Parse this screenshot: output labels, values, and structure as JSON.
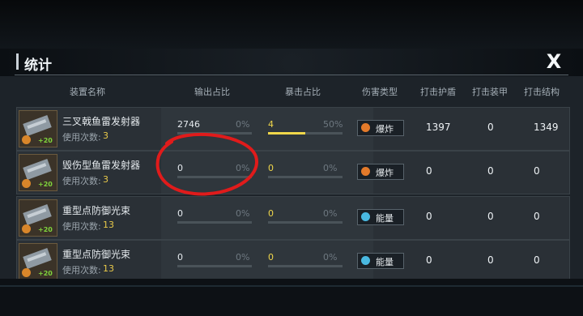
{
  "dialog": {
    "title": "统计",
    "close_label": "X"
  },
  "headers": {
    "equipment": "装置名称",
    "output": "输出占比",
    "crit": "暴击占比",
    "damage_type": "伤害类型",
    "shield": "打击护盾",
    "armor": "打击装甲",
    "structure": "打击结构"
  },
  "uses_label": "使用次数:",
  "rows": [
    {
      "name": "三叉戟鱼雷发射器",
      "uses": "3",
      "thumb_plus": "+20",
      "output_value": "2746",
      "output_pct": "0%",
      "crit_value": "4",
      "crit_pct": "50%",
      "crit_fill": 0.5,
      "damage_type": "爆炸",
      "damage_icon": "explosion-icon",
      "damage_color": "#e37a2a",
      "shield": "1397",
      "armor": "0",
      "structure": "1349"
    },
    {
      "name": "毁伤型鱼雷发射器",
      "uses": "3",
      "thumb_plus": "+20",
      "output_value": "0",
      "output_pct": "0%",
      "crit_value": "0",
      "crit_pct": "0%",
      "crit_fill": 0,
      "damage_type": "爆炸",
      "damage_icon": "explosion-icon",
      "damage_color": "#e37a2a",
      "shield": "0",
      "armor": "0",
      "structure": "0"
    },
    {
      "name": "重型点防御光束",
      "uses": "13",
      "thumb_plus": "+20",
      "output_value": "0",
      "output_pct": "0%",
      "crit_value": "0",
      "crit_pct": "0%",
      "crit_fill": 0,
      "damage_type": "能量",
      "damage_icon": "energy-icon",
      "damage_color": "#49b8e0",
      "shield": "0",
      "armor": "0",
      "structure": "0"
    },
    {
      "name": "重型点防御光束",
      "uses": "13",
      "thumb_plus": "+20",
      "output_value": "0",
      "output_pct": "0%",
      "crit_value": "0",
      "crit_pct": "0%",
      "crit_fill": 0,
      "damage_type": "能量",
      "damage_icon": "energy-icon",
      "damage_color": "#49b8e0",
      "shield": "0",
      "armor": "0",
      "structure": "0"
    }
  ]
}
